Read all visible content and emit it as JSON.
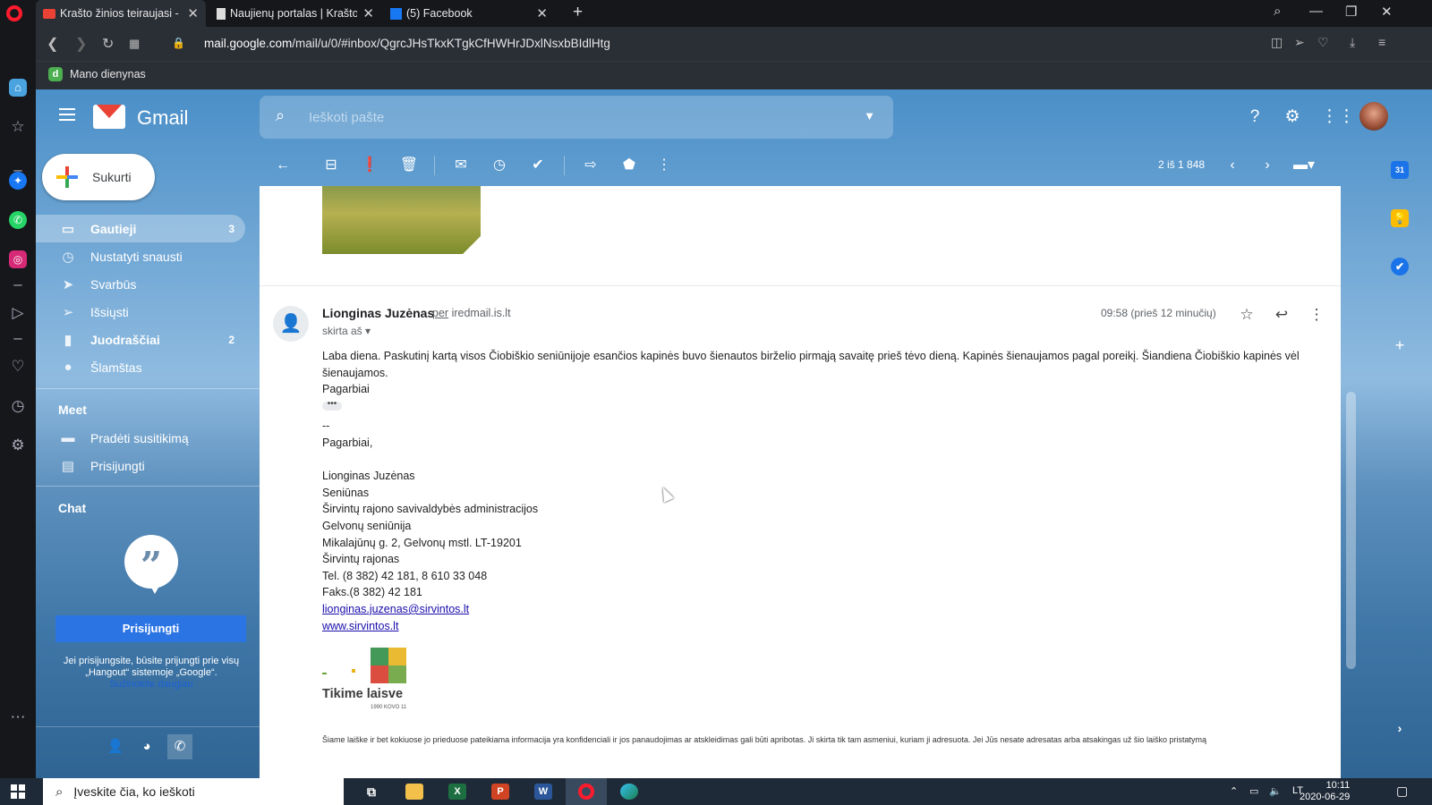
{
  "browser": {
    "tabs": [
      {
        "label": "Krašto žinios teiraujasi - n.t",
        "active": true,
        "favicon": "gmail-icon"
      },
      {
        "label": "Naujienų portalas | Krašto ž",
        "active": false,
        "favicon": "document-icon"
      },
      {
        "label": "(5) Facebook",
        "active": false,
        "favicon": "facebook-icon"
      }
    ],
    "url_domain": "mail.google.com",
    "url_path": "/mail/u/0/#inbox/QgrcJHsTkxKTgkCfHWHrJDxlNsxbBIdlHtg",
    "bookmark_icon_letter": "d",
    "bookmark_label": "Mano dienynas"
  },
  "gmail": {
    "app_name": "Gmail",
    "search_placeholder": "Ieškoti pašte",
    "compose_label": "Sukurti",
    "nav": [
      {
        "label": "Gautieji",
        "count": "3",
        "icon": "inbox-icon",
        "active": true
      },
      {
        "label": "Nustatyti snausti",
        "count": "",
        "icon": "clock-icon",
        "active": false
      },
      {
        "label": "Svarbūs",
        "count": "",
        "icon": "important-icon",
        "active": false
      },
      {
        "label": "Išsiųsti",
        "count": "",
        "icon": "send-icon",
        "active": false
      },
      {
        "label": "Juodraščiai",
        "count": "2",
        "icon": "draft-icon",
        "active": false
      },
      {
        "label": "Šlamštas",
        "count": "",
        "icon": "spam-icon",
        "active": false
      }
    ],
    "meet": {
      "title": "Meet",
      "items": [
        {
          "label": "Pradėti susitikimą",
          "icon": "video-icon"
        },
        {
          "label": "Prisijungti",
          "icon": "keyboard-icon"
        }
      ]
    },
    "chat": {
      "title": "Chat",
      "login_button": "Prisijungti",
      "info_text": "Jei prisijungsite, būsite prijungti prie visų „Hangout“ sistemoje „Google“.",
      "learn_more": "Sužinokite daugiau"
    },
    "pager": "2 iš 1 848"
  },
  "message": {
    "sender": "Lionginas Juzėnas",
    "via_word": "per",
    "via_domain": "iredmail.is.lt",
    "to_line": "skirta aš",
    "time": "09:58 (prieš 12 minučių)",
    "body_main": "Laba diena. Paskutinį kartą visos Čiobiškio seniūnijoje esančios kapinės buvo šienautos birželio pirmąją savaitę prieš tėvo dieną. Kapinės šienaujamos pagal poreikį. Šiandiena Čiobiškio kapinės vėl šienaujamos.",
    "body_closing": "Pagarbiai",
    "sig_dash": "--",
    "sig_greeting": "Pagarbiai,",
    "signature": [
      "Lionginas Juzėnas",
      "Seniūnas",
      "Širvintų rajono savivaldybės administracijos",
      "Gelvonų seniūnija",
      "Mikalajūnų g. 2, Gelvonų mstl. LT-19201",
      "Širvintų rajonas",
      "Tel. (8 382) 42 181, 8 610 33 048",
      "Faks.(8 382) 42 181"
    ],
    "email_link": "lionginas.juzenas@sirvintos.lt",
    "web_link": "www.sirvintos.lt",
    "logo_text": "Tikime laisve",
    "logo_date": "1990 KOVO 11",
    "disclaimer": "Šiame laiške ir bet kokiuose jo prieduose pateikiama informacija yra konfidenciali ir jos panaudojimas ar atskleidimas gali būti apribotas. Ji skirta tik tam asmeniui, kuriam ji adresuota. Jei Jūs nesate adresatas arba atsakingas už šio laiško pristatymą"
  },
  "taskbar": {
    "search_placeholder": "Įveskite čia, ko ieškoti",
    "language": "LT",
    "time": "10:11",
    "date": "2020-06-29"
  }
}
